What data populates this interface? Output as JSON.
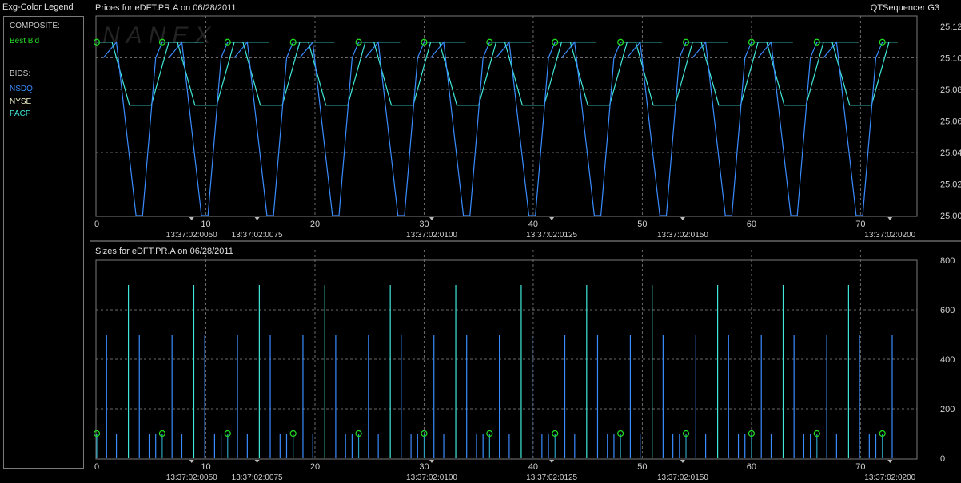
{
  "legend": {
    "title": "Exg-Color Legend",
    "composite_heading": "COMPOSITE:",
    "composite_items": [
      {
        "label": "Best Bid",
        "color": "#22dd22"
      }
    ],
    "bids_heading": "BIDS:",
    "bid_items": [
      {
        "label": "NSDQ",
        "color": "#3a8cff"
      },
      {
        "label": "NYSE",
        "color": "#f0f0c8"
      },
      {
        "label": "PACF",
        "color": "#40e8d8"
      }
    ]
  },
  "header": {
    "prices_title": "Prices for  eDFT.PR.A  on  06/28/2011",
    "sizes_title": "Sizes for  eDFT.PR.A  on  06/28/2011",
    "app_name": "QTSequencer G3",
    "watermark": "NANEX"
  },
  "chart_data": [
    {
      "type": "line",
      "title": "Prices for  eDFT.PR.A  on  06/28/2011",
      "xlim": [
        0,
        74
      ],
      "ylim": [
        25.0,
        25.12
      ],
      "x_ticks": [
        "0",
        "10",
        "20",
        "30",
        "40",
        "50",
        "60",
        "70"
      ],
      "y_ticks": [
        "25.12",
        "25.10",
        "25.08",
        "25.06",
        "25.04",
        "25.02",
        "25.00"
      ],
      "time_labels": [
        {
          "x": 8.7,
          "label": "13:37:02:0050"
        },
        {
          "x": 14.7,
          "label": "13:37:02:0075"
        },
        {
          "x": 30.7,
          "label": "13:37:02:0100"
        },
        {
          "x": 41.7,
          "label": "13:37:02:0125"
        },
        {
          "x": 53.7,
          "label": "13:37:02:0150"
        },
        {
          "x": 72.7,
          "label": "13:37:02:0200"
        }
      ],
      "grid": true,
      "period": 6,
      "series": [
        {
          "name": "PACF",
          "color": "#40e8d8",
          "x": [
            0,
            1.4,
            3,
            5,
            6.6,
            8.2,
            9.8
          ],
          "y": [
            25.11,
            25.11,
            25.07,
            25.07,
            25.11,
            25.11,
            25.11
          ]
        },
        {
          "name": "NSDQ",
          "color": "#3a8cff",
          "x": [
            0.6,
            1.8,
            3.6,
            4.2,
            5.4,
            6.0
          ],
          "y": [
            25.1,
            25.11,
            25.0,
            25.0,
            25.1,
            25.11
          ]
        },
        {
          "name": "Best Bid",
          "color": "#22dd22",
          "x": [
            0,
            6,
            12,
            18,
            24,
            30,
            36,
            42,
            48,
            54,
            60,
            66,
            72
          ],
          "y": [
            25.11,
            25.11,
            25.11,
            25.11,
            25.11,
            25.11,
            25.11,
            25.11,
            25.11,
            25.11,
            25.11,
            25.11,
            25.11
          ]
        }
      ]
    },
    {
      "type": "bar",
      "title": "Sizes for  eDFT.PR.A  on  06/28/2011",
      "xlim": [
        0,
        74
      ],
      "ylim": [
        0,
        800
      ],
      "x_ticks": [
        "0",
        "10",
        "20",
        "30",
        "40",
        "50",
        "60",
        "70"
      ],
      "y_ticks": [
        "800",
        "600",
        "400",
        "200",
        "0"
      ],
      "grid": true,
      "period": 6,
      "series": [
        {
          "name": "NSDQ",
          "color": "#3a8cff",
          "x": [
            0.9,
            1.8,
            3.9,
            4.8,
            5.4
          ],
          "values": [
            500,
            100,
            500,
            100,
            100
          ]
        },
        {
          "name": "PACF",
          "color": "#40e8d8",
          "x": [
            2.9
          ],
          "values": [
            700
          ]
        },
        {
          "name": "Best Bid",
          "color": "#22dd22",
          "x": [
            0,
            6,
            12,
            18,
            24,
            30,
            36,
            42,
            48,
            54,
            60,
            66,
            72
          ],
          "values": [
            100,
            100,
            100,
            100,
            100,
            100,
            100,
            100,
            100,
            100,
            100,
            100,
            100
          ]
        }
      ]
    }
  ]
}
